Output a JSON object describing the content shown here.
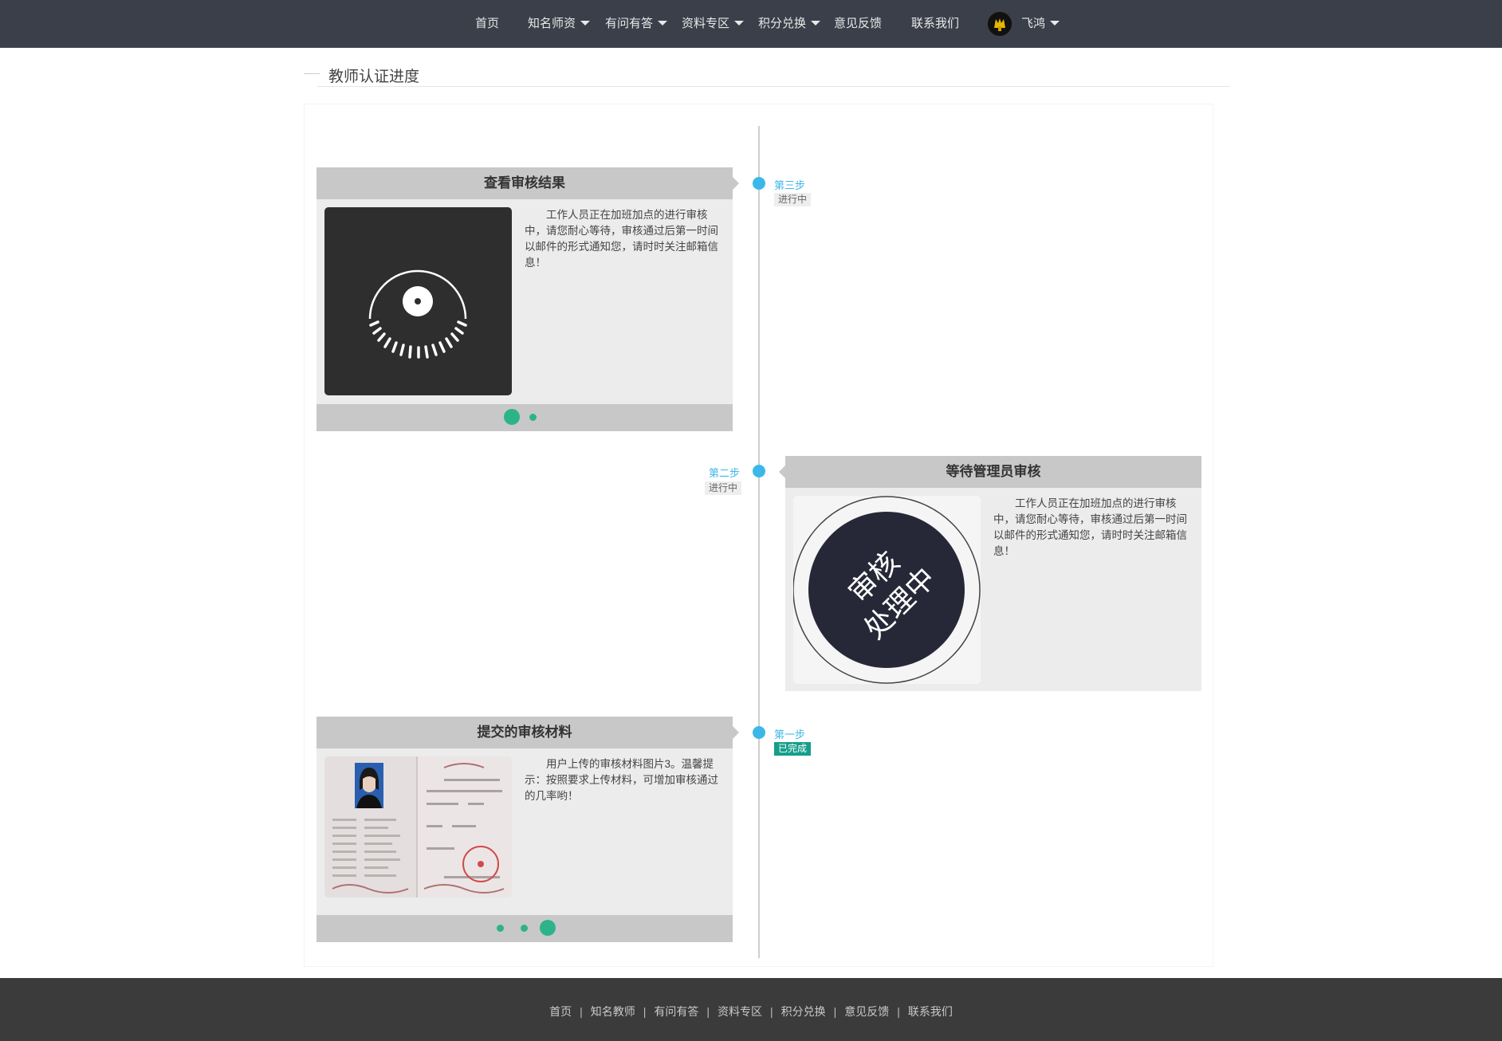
{
  "nav": {
    "items": [
      {
        "label": "首页"
      },
      {
        "label": "知名师资"
      },
      {
        "label": "有问有答"
      },
      {
        "label": "资料专区"
      },
      {
        "label": "积分兑换"
      },
      {
        "label": "意见反馈"
      },
      {
        "label": "联系我们"
      }
    ],
    "user": {
      "name": "飞鸿"
    }
  },
  "page": {
    "title": "教师认证进度"
  },
  "timeline": {
    "steps": [
      {
        "step": "第三步",
        "status": "进行中",
        "card_title": "查看审核结果",
        "text": "工作人员正在加班加点的进行审核中，请您耐心等待，审核通过后第一时间以邮件的形式通知您，请时时关注邮箱信息！"
      },
      {
        "step": "第二步",
        "status": "进行中",
        "card_title": "等待管理员审核",
        "stamp_line1": "审核",
        "stamp_line2": "处理中",
        "text": "工作人员正在加班加点的进行审核中，请您耐心等待，审核通过后第一时间以邮件的形式通知您，请时时关注邮箱信息！"
      },
      {
        "step": "第一步",
        "status": "已完成",
        "card_title": "提交的审核材料",
        "text": "用户上传的审核材料图片3。温馨提示：按照要求上传材料，可增加审核通过的几率哟！"
      }
    ]
  },
  "footer": {
    "links": [
      "首页",
      "知名教师",
      "有问有答",
      "资料专区",
      "积分兑换",
      "意见反馈",
      "联系我们"
    ],
    "separator": "|"
  },
  "colors": {
    "nav_bg": "#3b3f4a",
    "accent_blue": "#3cb8e8",
    "done_green": "#169e8a",
    "pager_green": "#2db38a",
    "footer_bg": "#3b3b3c"
  }
}
